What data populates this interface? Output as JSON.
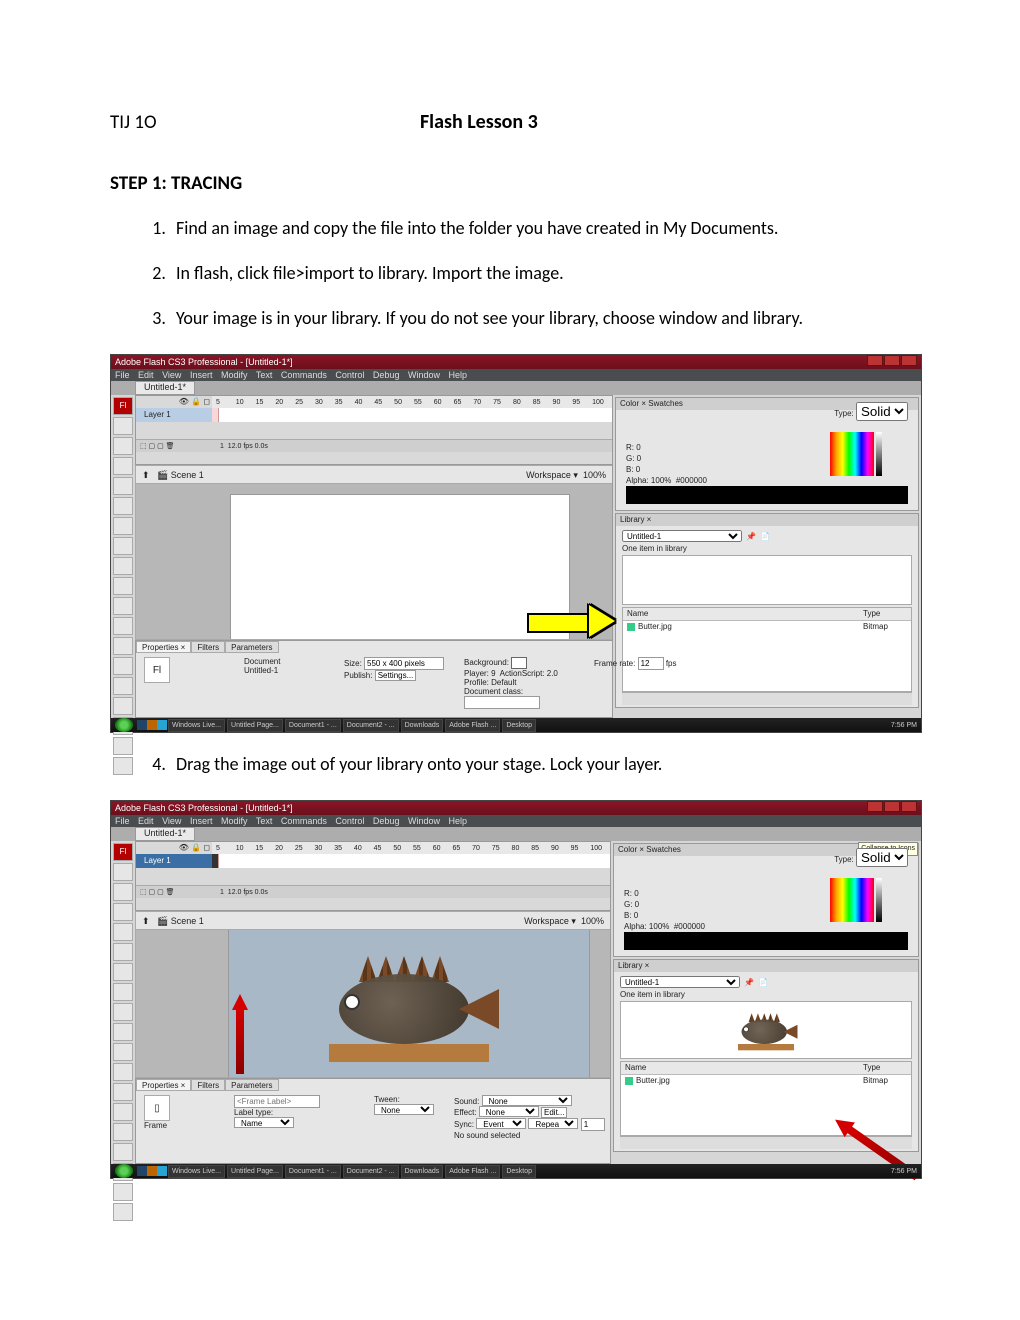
{
  "header": {
    "course": "TIJ 1O",
    "title": "Flash Lesson 3"
  },
  "step1": {
    "heading": "STEP 1: TRACING",
    "items": [
      "Find an image and copy the file into the folder you have created in My Documents.",
      "In flash, click file>import to library.  Import the image.",
      "Your image is in your library.  If you do not see your library, choose window and library."
    ],
    "item4": "Drag the image out of your library onto your stage.  Lock your layer."
  },
  "app": {
    "title": "Adobe Flash CS3 Professional - [Untitled-1*]",
    "menus": [
      "File",
      "Edit",
      "View",
      "Insert",
      "Modify",
      "Text",
      "Commands",
      "Control",
      "Debug",
      "Window",
      "Help"
    ],
    "docTab": "Untitled-1*",
    "layer": "Layer 1",
    "rulerMarks": [
      "5",
      "10",
      "15",
      "20",
      "25",
      "30",
      "35",
      "40",
      "45",
      "50",
      "55",
      "60",
      "65",
      "70",
      "75",
      "80",
      "85",
      "90",
      "95",
      "100"
    ],
    "tlStatus": "12.0 fps   0.0s",
    "frameIdx": "1",
    "scene": "Scene 1",
    "workspaceLabel": "Workspace ▾",
    "zoom": "100%"
  },
  "color": {
    "tab1": "Color ×",
    "tab2": "Swatches",
    "typeLabel": "Type:",
    "typeValue": "Solid",
    "r": "R: 0",
    "g": "G: 0",
    "b": "B: 0",
    "alphaLabel": "Alpha:",
    "alpha": "100%",
    "hex": "#000000"
  },
  "library": {
    "tab": "Library ×",
    "doc": "Untitled-1",
    "count": "One item in library",
    "colName": "Name",
    "colType": "Type",
    "itemName": "Butter.jpg",
    "itemType": "Bitmap"
  },
  "props1": {
    "tabs": [
      "Properties ×",
      "Filters",
      "Parameters"
    ],
    "docLabel": "Document",
    "docName": "Untitled-1",
    "sizeLabel": "Size:",
    "size": "550 x 400 pixels",
    "publishLabel": "Publish:",
    "settings": "Settings...",
    "bgLabel": "Background:",
    "frLabel": "Frame rate:",
    "fr": "12",
    "fps": "fps",
    "playerLabel": "Player:",
    "player": "9",
    "asLabel": "ActionScript:",
    "as": "2.0",
    "profileLabel": "Profile:",
    "profile": "Default",
    "docClassLabel": "Document class:"
  },
  "props2": {
    "tabs": [
      "Properties ×",
      "Filters",
      "Parameters"
    ],
    "frameLabel": "Frame",
    "tweenLabel": "Tween:",
    "tweenVal": "None",
    "soundLabel": "Sound:",
    "soundVal": "None",
    "effectLabel": "Effect:",
    "effectVal": "None",
    "editBtn": "Edit...",
    "syncLabel": "Sync:",
    "syncVal": "Event",
    "repeat": "Repeat",
    "times": "1",
    "labelTypeLabel": "Label type:",
    "labelType": "Name",
    "noSound": "No sound selected",
    "frameNameLabel": "<Frame Label>"
  },
  "taskbar": {
    "items": [
      "Windows Live...",
      "Untitled Page...",
      "Document1 - ...",
      "Document2 - ...",
      "Downloads",
      "Adobe Flash ...",
      "Desktop"
    ],
    "time": "7:56 PM"
  },
  "tooltip": "Collapse to Icons"
}
